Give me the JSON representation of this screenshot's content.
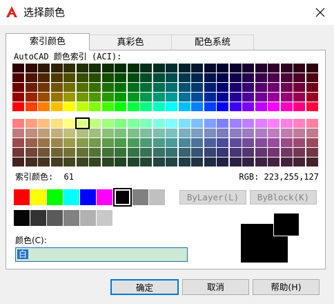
{
  "window": {
    "title": "选择颜色",
    "icon": "autocad-logo-icon"
  },
  "tabs": [
    {
      "label": "索引颜色",
      "active": true
    },
    {
      "label": "真彩色",
      "active": false
    },
    {
      "label": "配色系统",
      "active": false
    }
  ],
  "aci": {
    "label": "AutoCAD 颜色索引 (ACI):",
    "selected_index": 61,
    "selected_index_label": "索引颜色:",
    "selected_index_value": "61",
    "rgb_text": "RGB: 223,255,127"
  },
  "standard_colors": [
    {
      "name": "red",
      "hex": "#ff0000"
    },
    {
      "name": "yellow",
      "hex": "#ffff00"
    },
    {
      "name": "green",
      "hex": "#00ff00"
    },
    {
      "name": "cyan",
      "hex": "#00ffff"
    },
    {
      "name": "blue",
      "hex": "#0000ff"
    },
    {
      "name": "magenta",
      "hex": "#ff00ff"
    },
    {
      "name": "black",
      "hex": "#000000",
      "selected": true
    },
    {
      "name": "gray-8",
      "hex": "#808080"
    },
    {
      "name": "gray-9",
      "hex": "#c0c0c0"
    }
  ],
  "gray_colors": [
    "#050505",
    "#333333",
    "#5a5a5a",
    "#828282",
    "#b2b2b2",
    "#c8c8c8"
  ],
  "buttons": {
    "bylayer": "ByLayer(L)",
    "byblock": "ByBlock(K)",
    "ok": "确定",
    "cancel": "取消",
    "help": "帮助(H)"
  },
  "color_field": {
    "label": "颜色(C):",
    "value": "白"
  },
  "preview": {
    "old_color": "#000000",
    "new_color": "#000000"
  }
}
